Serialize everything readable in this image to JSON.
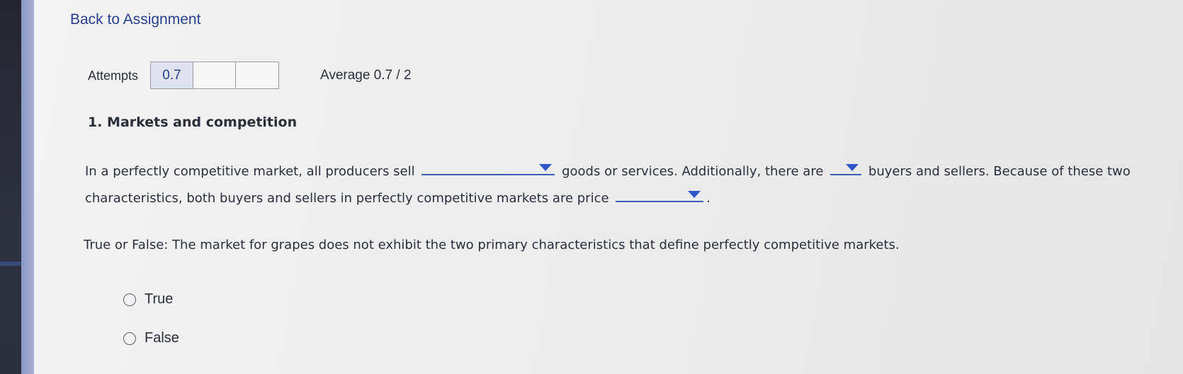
{
  "header": {
    "back_link": "Back to Assignment"
  },
  "attempts": {
    "label": "Attempts",
    "boxes": [
      "0.7",
      "",
      ""
    ],
    "average": "Average 0.7 / 2"
  },
  "question": {
    "title": "1. Markets and competition",
    "sentence_part1": "In a perfectly competitive market, all producers sell",
    "sentence_part2": "goods or services. Additionally, there are",
    "sentence_part3": "buyers and sellers. Because of these two characteristics, both buyers and sellers in perfectly competitive markets are price",
    "sentence_end": ".",
    "tf_prompt": "True or False: The market for grapes does not exhibit the two primary characteristics that define perfectly competitive markets.",
    "options": [
      "True",
      "False"
    ]
  },
  "colors": {
    "link": "#2a3f8f",
    "dropdown_accent": "#2f55c8",
    "left_stripe": "#8b97c4"
  }
}
